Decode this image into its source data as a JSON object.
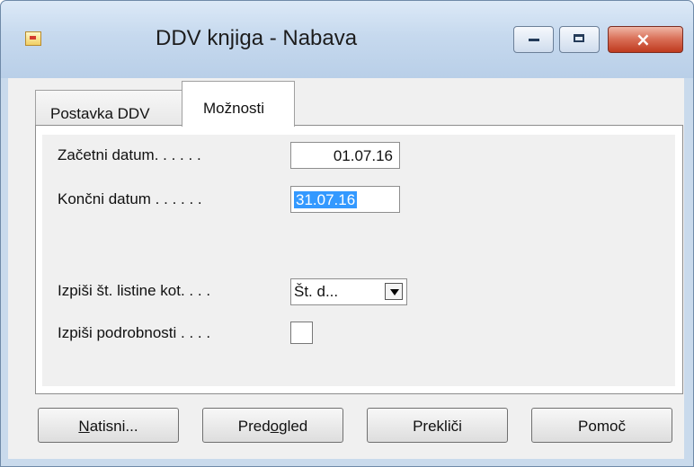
{
  "window": {
    "title": "DDV knjiga - Nabava"
  },
  "tabs": [
    {
      "label": "Postavka DDV"
    },
    {
      "label": "Možnosti"
    }
  ],
  "fields": {
    "start_date": {
      "label": "Začetni datum. . . . . .",
      "value": "01.07.16"
    },
    "end_date": {
      "label": "Končni datum . . . . . .",
      "value": "31.07.16"
    },
    "document_number": {
      "label": "Izpiši št. listine kot. . . .",
      "value": "Št. d..."
    },
    "details": {
      "label": "Izpiši podrobnosti . . . ."
    }
  },
  "buttons": {
    "print": {
      "mnemonic": "N",
      "rest": "atisni..."
    },
    "preview": {
      "before": "Pred",
      "mnemonic": "o",
      "after": "gled"
    },
    "cancel": "Prekliči",
    "help": "Pomoč"
  }
}
